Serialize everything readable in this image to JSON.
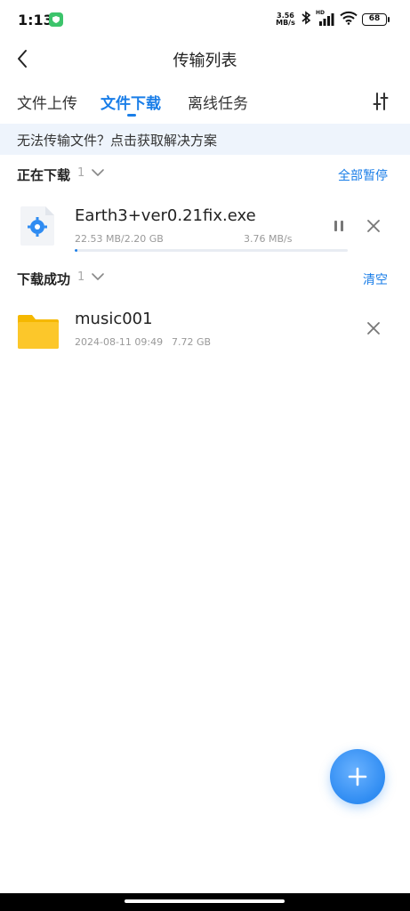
{
  "status_bar": {
    "time": "1:13",
    "net_speed_value": "3.56",
    "net_speed_unit": "MB/s",
    "signal_label": "HD",
    "battery": "68"
  },
  "header": {
    "title": "传输列表"
  },
  "tabs": [
    {
      "label": "文件上传",
      "active": false
    },
    {
      "label": "文件下载",
      "active": true
    },
    {
      "label": "离线任务",
      "active": false
    }
  ],
  "banner": {
    "text": "无法传输文件？点击获取解决方案"
  },
  "downloading": {
    "title": "正在下载",
    "count": "1",
    "action": "全部暂停",
    "items": [
      {
        "name": "Earth3+ver0.21fix.exe",
        "progress_text": "22.53 MB/2.20 GB",
        "speed": "3.76 MB/s",
        "progress_fraction": 0.01
      }
    ]
  },
  "completed": {
    "title": "下载成功",
    "count": "1",
    "action": "清空",
    "items": [
      {
        "name": "music001",
        "date": "2024-08-11 09:49",
        "size": "7.72 GB"
      }
    ]
  },
  "colors": {
    "accent": "#1a7ee8",
    "banner_bg": "#eef4fc",
    "folder": "#fcc72a"
  },
  "icons": {
    "back": "chevron-left-icon",
    "filter": "filter-sliders-icon",
    "exe_file": "gear-file-icon",
    "folder": "folder-icon",
    "pause": "pause-icon",
    "close": "close-icon",
    "add": "plus-icon"
  }
}
